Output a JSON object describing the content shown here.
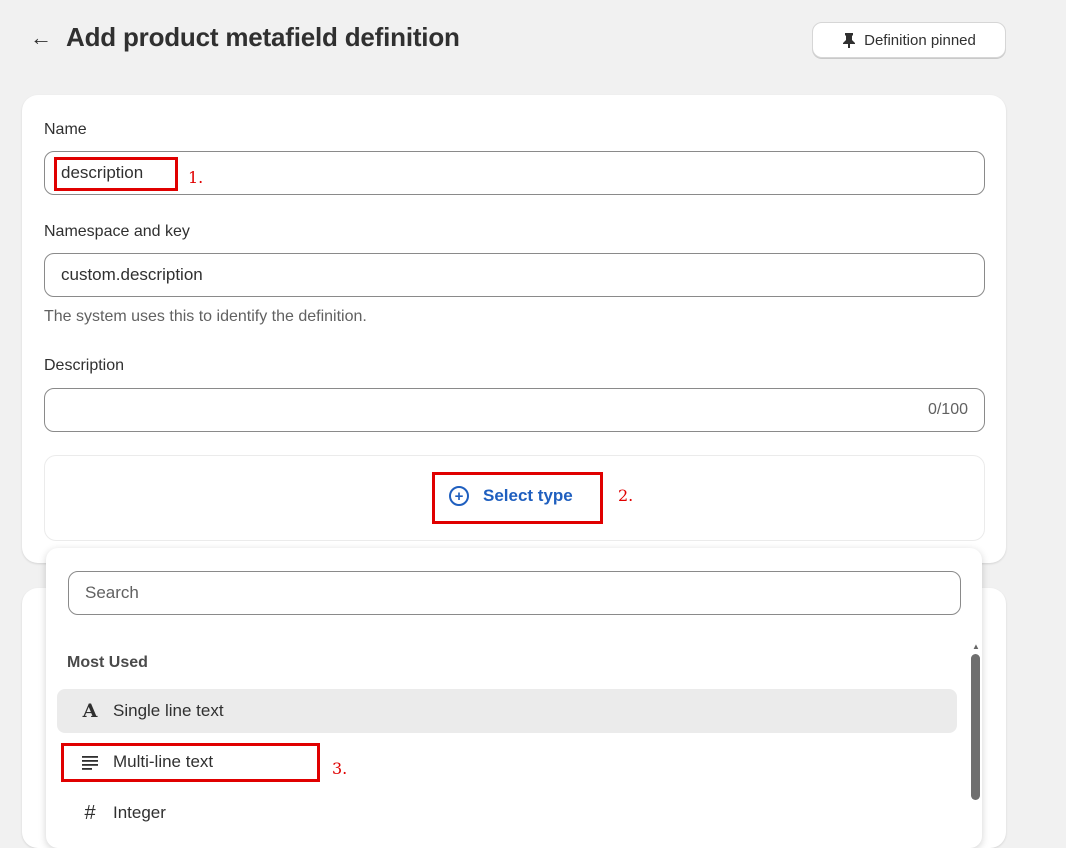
{
  "header": {
    "back_icon": "arrow-left-icon",
    "title": "Add product metafield definition",
    "pin_icon": "pin-icon",
    "pin_label": "Definition pinned"
  },
  "form": {
    "name_label": "Name",
    "name_value": "description",
    "namespace_label": "Namespace and key",
    "namespace_value": "custom.description",
    "namespace_helper": "The system uses this to identify the definition.",
    "description_label": "Description",
    "description_value": "",
    "description_counter": "0/100",
    "select_type_icon": "plus-circle-icon",
    "select_type_label": "Select type"
  },
  "type_picker": {
    "search_placeholder": "Search",
    "section_label": "Most Used",
    "items": [
      {
        "icon": "A",
        "icon_name": "text-a-icon",
        "label": "Single line text",
        "highlighted": true
      },
      {
        "icon": "≡",
        "icon_name": "multiline-text-icon",
        "label": "Multi-line text",
        "highlighted": false
      },
      {
        "icon": "#",
        "icon_name": "hash-icon",
        "label": "Integer",
        "highlighted": false
      }
    ]
  },
  "annotations": {
    "step1": "1.",
    "step2": "2.",
    "step3": "3.",
    "color": "#e00000"
  },
  "colors": {
    "background": "#f1f1f1",
    "link_blue": "#1f5fbf",
    "highlight": "#ebebeb"
  }
}
